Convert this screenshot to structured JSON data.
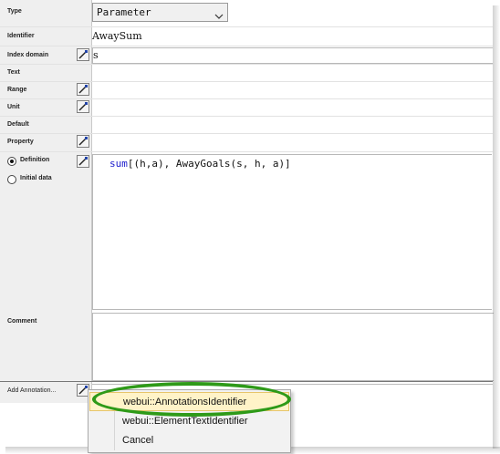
{
  "labels": {
    "type": "Type",
    "identifier": "Identifier",
    "index_domain": "Index domain",
    "text": "Text",
    "range": "Range",
    "unit": "Unit",
    "default": "Default",
    "property": "Property",
    "definition": "Definition",
    "initial_data": "Initial data",
    "comment": "Comment",
    "add_annotation": "Add Annotation..."
  },
  "type_select": {
    "value": "Parameter"
  },
  "fields": {
    "identifier": "AwaySum",
    "index_domain": "s",
    "text": "",
    "range": "",
    "unit": "",
    "default": "",
    "property": ""
  },
  "definition": {
    "keyword": "sum",
    "rest": "[(h,a), AwayGoals(s, h, a)]",
    "selected_radio": "definition"
  },
  "comment": "",
  "annotation_menu": {
    "items": [
      {
        "label": "webui::AnnotationsIdentifier",
        "highlighted": true
      },
      {
        "label": "webui::ElementTextIdentifier",
        "highlighted": false
      },
      {
        "label": "Cancel",
        "highlighted": false
      }
    ]
  },
  "colors": {
    "highlight_oval": "#2e9a18",
    "menu_highlight": "#fff3c8",
    "keyword": "#1a1acc"
  },
  "icons": {
    "wizard_button": "wizard-wand-icon",
    "dropdown": "chevron-down-icon"
  }
}
